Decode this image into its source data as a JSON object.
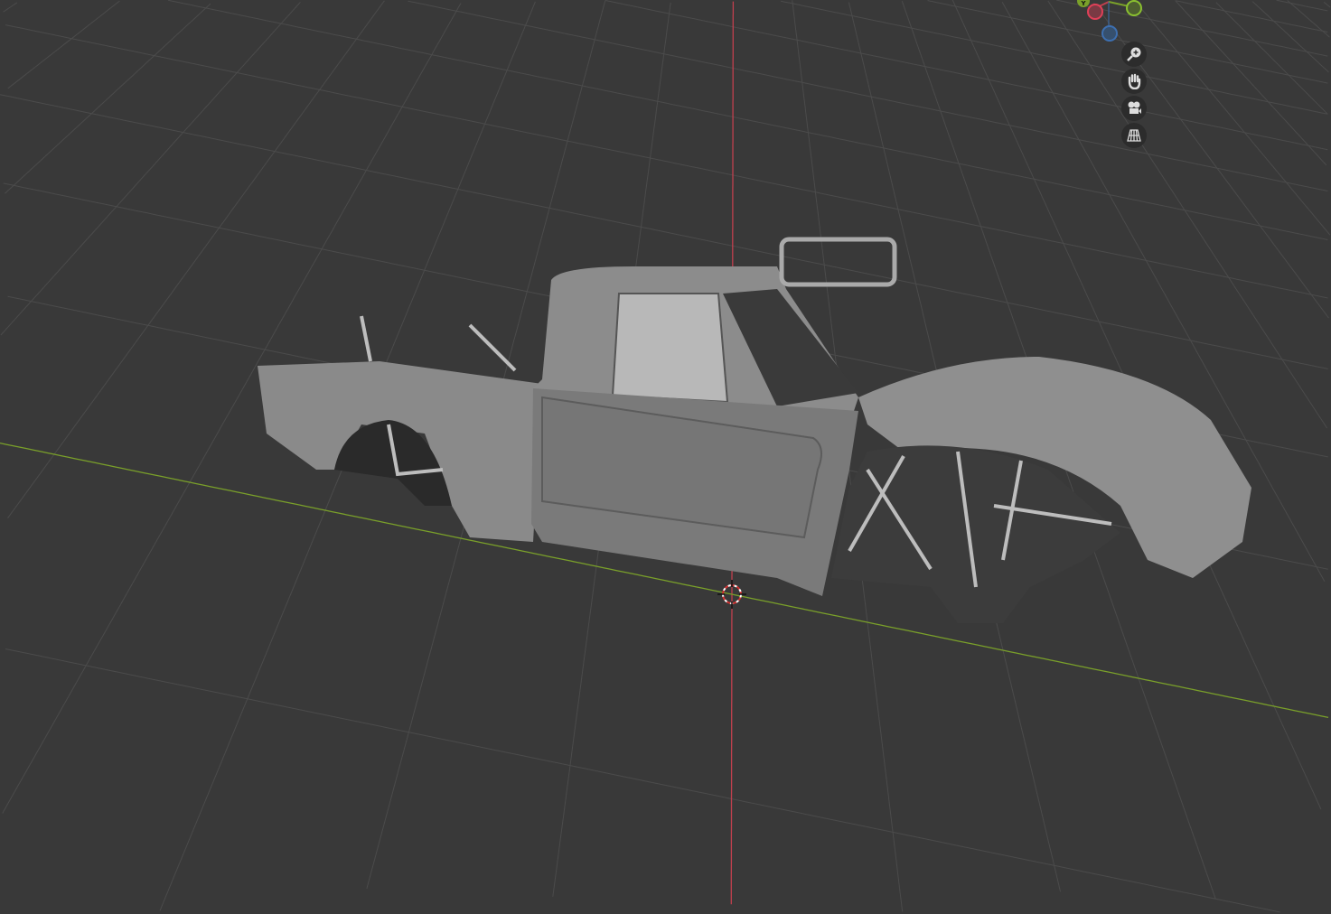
{
  "app": "3D Viewport",
  "colors": {
    "background": "#393939",
    "grid": "#4a4a4a",
    "x_axis": "#c0404e",
    "y_axis": "#7aa02a",
    "z_axis": "#3d6fb0"
  },
  "gizmo": {
    "y_label": "Y",
    "axes": [
      "x-axis",
      "y-axis",
      "z-axis"
    ]
  },
  "navigation": [
    {
      "id": "zoom",
      "icon": "zoom-icon"
    },
    {
      "id": "pan",
      "icon": "hand-icon"
    },
    {
      "id": "camera",
      "icon": "camera-icon"
    },
    {
      "id": "perspective",
      "icon": "grid-perspective-icon"
    }
  ],
  "model": {
    "object": "trophy-truck"
  }
}
